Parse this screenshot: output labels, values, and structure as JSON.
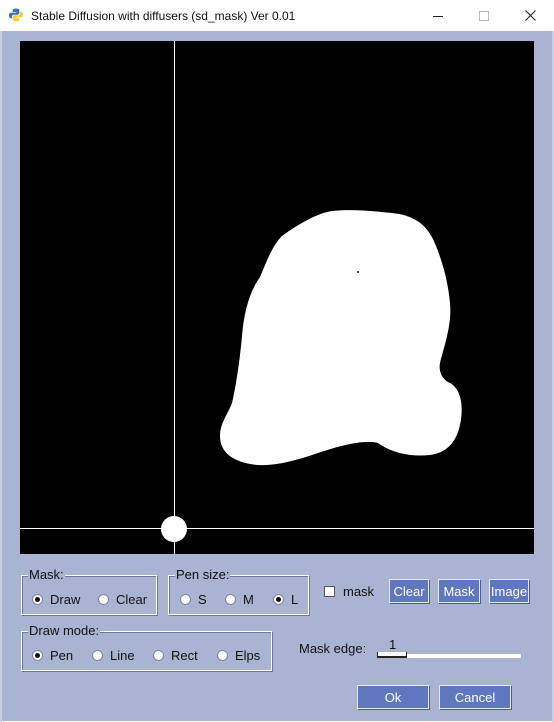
{
  "window": {
    "title": "Stable Diffusion with diffusers (sd_mask)  Ver 0.01",
    "icon": "python-icon",
    "controls": [
      "minimize-icon",
      "maximize-icon",
      "close-icon"
    ]
  },
  "canvas": {
    "background": "#000000",
    "mask_color": "#ffffff"
  },
  "mask_group": {
    "title": "Mask:",
    "options": [
      {
        "label": "Draw",
        "selected": true
      },
      {
        "label": "Clear",
        "selected": false
      }
    ]
  },
  "pen_size_group": {
    "title": "Pen size:",
    "options": [
      {
        "label": "S",
        "selected": false
      },
      {
        "label": "M",
        "selected": false
      },
      {
        "label": "L",
        "selected": true
      }
    ]
  },
  "mask_checkbox": {
    "label": "mask",
    "checked": false
  },
  "buttons": {
    "clear": "Clear",
    "mask": "Mask",
    "image": "Image",
    "ok": "Ok",
    "cancel": "Cancel"
  },
  "draw_mode_group": {
    "title": "Draw mode:",
    "options": [
      {
        "label": "Pen",
        "selected": true
      },
      {
        "label": "Line",
        "selected": false
      },
      {
        "label": "Rect",
        "selected": false
      },
      {
        "label": "Elps",
        "selected": false
      }
    ]
  },
  "mask_edge": {
    "label": "Mask edge:",
    "value": "1",
    "min": 0,
    "max": 10
  },
  "colors": {
    "client_background": "#a9b4d2",
    "button_background": "#5f76c1"
  }
}
